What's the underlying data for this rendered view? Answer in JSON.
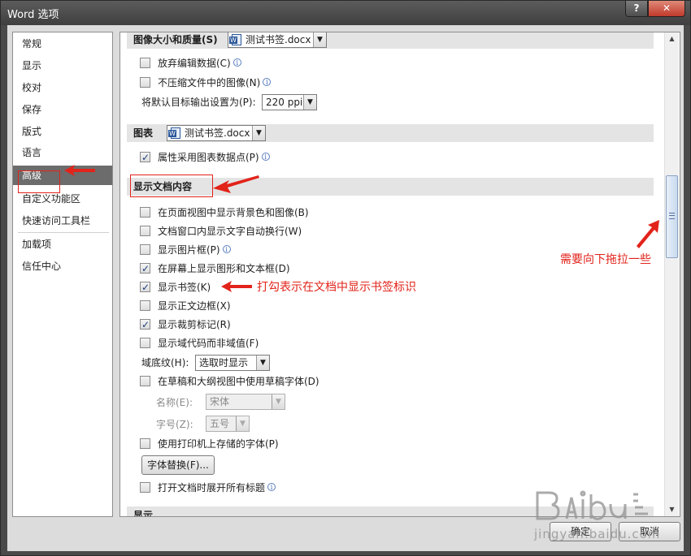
{
  "window": {
    "title": "Word 选项",
    "help_label": "?",
    "close_label": "✕"
  },
  "nav": {
    "items": [
      {
        "label": "常规"
      },
      {
        "label": "显示"
      },
      {
        "label": "校对"
      },
      {
        "label": "保存"
      },
      {
        "label": "版式"
      },
      {
        "label": "语言"
      },
      {
        "label": "高级",
        "selected": true
      },
      {
        "label": "自定义功能区"
      },
      {
        "label": "快速访问工具栏"
      },
      {
        "label": "加载项"
      },
      {
        "label": "信任中心"
      }
    ]
  },
  "image_section": {
    "header": "图像大小和质量(S)",
    "doc": "测试书签.docx",
    "discard_edit": {
      "label": "放弃编辑数据(C)",
      "checked": false
    },
    "no_compress": {
      "label": "不压缩文件中的图像(N)",
      "checked": false
    },
    "default_output_label": "将默认目标输出设置为(P):",
    "default_output_value": "220 ppi"
  },
  "chart_section": {
    "header": "图表",
    "doc": "测试书签.docx",
    "prop_follow": {
      "label": "属性采用图表数据点(P)",
      "checked": true
    }
  },
  "display_doc_section": {
    "header": "显示文档内容",
    "options": [
      {
        "label": "在页面视图中显示背景色和图像(B)",
        "checked": false,
        "info": false
      },
      {
        "label": "文档窗口内显示文字自动换行(W)",
        "checked": false,
        "info": false
      },
      {
        "label": "显示图片框(P)",
        "checked": false,
        "info": true
      },
      {
        "label": "在屏幕上显示图形和文本框(D)",
        "checked": true,
        "info": false
      },
      {
        "label": "显示书签(K)",
        "checked": true,
        "info": false
      },
      {
        "label": "显示正文边框(X)",
        "checked": false,
        "info": false
      },
      {
        "label": "显示裁剪标记(R)",
        "checked": true,
        "info": false
      },
      {
        "label": "显示域代码而非域值(F)",
        "checked": false,
        "info": false
      }
    ],
    "field_shading_label": "域底纹(H):",
    "field_shading_value": "选取时显示",
    "draft_font": {
      "label": "在草稿和大纲视图中使用草稿字体(D)",
      "checked": false
    },
    "name_label": "名称(E):",
    "name_value": "宋体",
    "size_label": "字号(Z):",
    "size_value": "五号",
    "printer_fonts": {
      "label": "使用打印机上存储的字体(P)",
      "checked": false
    },
    "font_sub_label": "字体替换(F)...",
    "expand_headings": {
      "label": "打开文档时展开所有标题",
      "checked": false
    }
  },
  "next_section": {
    "header": "显示"
  },
  "footer": {
    "ok_label": "确定",
    "cancel_label": "取消"
  },
  "annotations": {
    "bookmark_note": "打勾表示在文档中显示书签标识",
    "drag_note": "需要向下拖拉一些",
    "color": "#e2231a"
  },
  "watermark": {
    "text": "jingyan.baidu.com"
  },
  "icons": {
    "info": "i",
    "dropdown": "▼",
    "scroll_up": "▲",
    "scroll_down": "▼"
  }
}
